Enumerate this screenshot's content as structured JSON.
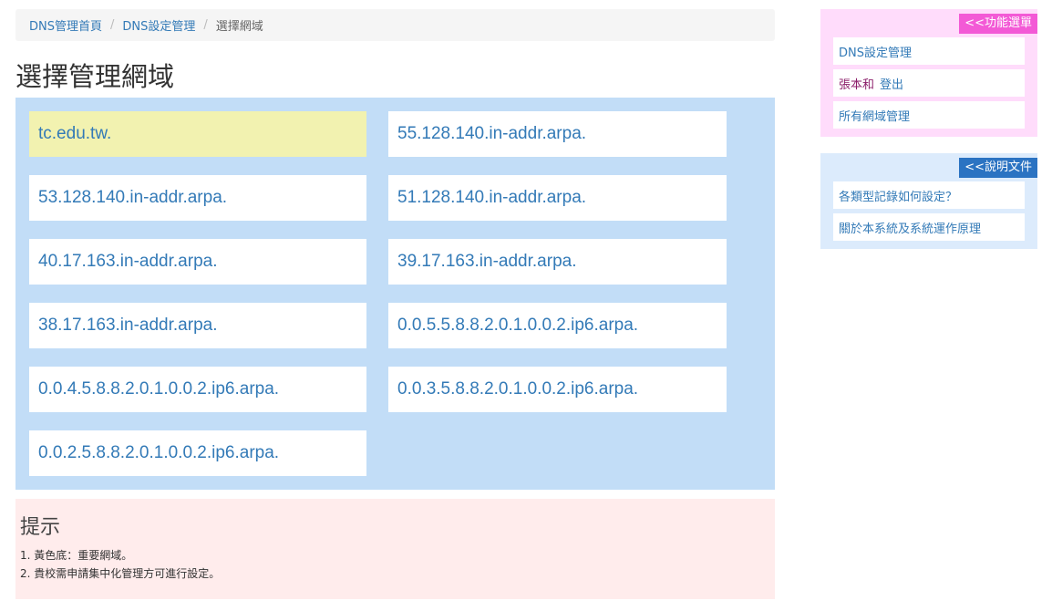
{
  "breadcrumb": {
    "home": "DNS管理首頁",
    "settings": "DNS設定管理",
    "current": "選擇網域",
    "separator": "/"
  },
  "page_title": "選擇管理網域",
  "domains": [
    {
      "name": "tc.edu.tw.",
      "important": true
    },
    {
      "name": "55.128.140.in-addr.arpa.",
      "important": false
    },
    {
      "name": "53.128.140.in-addr.arpa.",
      "important": false
    },
    {
      "name": "51.128.140.in-addr.arpa.",
      "important": false
    },
    {
      "name": "40.17.163.in-addr.arpa.",
      "important": false
    },
    {
      "name": "39.17.163.in-addr.arpa.",
      "important": false
    },
    {
      "name": "38.17.163.in-addr.arpa.",
      "important": false
    },
    {
      "name": "0.0.5.5.8.8.2.0.1.0.0.2.ip6.arpa.",
      "important": false
    },
    {
      "name": "0.0.4.5.8.8.2.0.1.0.0.2.ip6.arpa.",
      "important": false
    },
    {
      "name": "0.0.3.5.8.8.2.0.1.0.0.2.ip6.arpa.",
      "important": false
    },
    {
      "name": "0.0.2.5.8.8.2.0.1.0.0.2.ip6.arpa.",
      "important": false
    }
  ],
  "hint": {
    "title": "提示",
    "lines": [
      "1. 黃色底：重要網域。",
      "2. 貴校需申請集中化管理方可進行設定。"
    ]
  },
  "function_menu": {
    "tag": "<<功能選單",
    "dns_settings": "DNS設定管理",
    "username": "張本和",
    "logout": "登出",
    "all_domains": "所有網域管理"
  },
  "docs_menu": {
    "tag": "<<說明文件",
    "items": [
      "各類型記錄如何設定？",
      "關於本系統及系統運作原理"
    ]
  },
  "colors": {
    "link": "#337ab7",
    "domain_panel_bg": "#c2ddf7",
    "important_bg": "#f2f2b0",
    "hint_bg": "#ffecec",
    "function_menu_bg": "#ffdcfb",
    "function_tag_bg": "#f35ad6",
    "docs_menu_bg": "#dcebfc",
    "docs_tag_bg": "#2b73c2"
  }
}
